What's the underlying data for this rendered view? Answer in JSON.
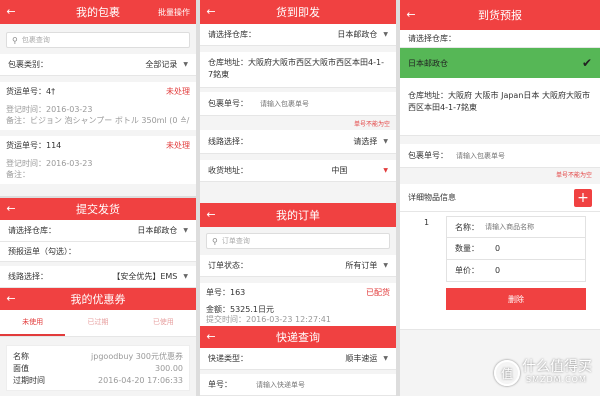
{
  "p1": {
    "title": "我的包裹",
    "action": "批量操作",
    "search_placeholder": "包裹查询",
    "category_label": "包裹类别：",
    "category_value": "全部记录",
    "items": [
      {
        "no_label": "货运单号：4†",
        "status": "未处理",
        "date": "登记时间：2016-03-23",
        "note": "备注：ビジョン 泡シャンプー ボトル 350ml (0 ≙/ι..."
      },
      {
        "no_label": "货运单号：114",
        "status": "未处理",
        "date": "登记时间：2016-03-23",
        "note": "备注："
      }
    ]
  },
  "p2": {
    "title": "提交发货",
    "warehouse_label": "请选择仓库：",
    "warehouse_value": "日本邮政仓",
    "prebook_label": "预报运单（勾选）：",
    "route_label": "线路选择：",
    "route_value": "【安全优先】EMS"
  },
  "p3": {
    "title": "我的优惠券",
    "tabs": [
      "未使用",
      "已过期",
      "已使用"
    ],
    "name_label": "名称",
    "name_value": "jpgoodbuy 300元优惠券",
    "value_label": "面值",
    "value_value": "300.00",
    "time_label": "过期时间",
    "time_value": "2016-04-20 17:06:33"
  },
  "p4": {
    "title": "货到即发",
    "warehouse_label": "请选择仓库：",
    "warehouse_value": "日本邮政仓",
    "address": "仓库地址：大阪府大阪市西区大阪市西区本田4-1-7銘東",
    "pkg_label": "包裹单号：",
    "pkg_placeholder": "请输入包裹单号",
    "error": "单号不能为空",
    "route_label": "线路选择：",
    "route_value": "请选择",
    "recv_label": "收货地址：",
    "recv_value": "中国"
  },
  "p5": {
    "title": "我的订单",
    "search_placeholder": "订单查询",
    "status_label": "订单状态：",
    "status_value": "所有订单",
    "order_no": "单号：163",
    "order_status": "已配货",
    "amount": "金额：5325.1日元",
    "time": "提交时间：2016-03-23 12:27:41"
  },
  "p6": {
    "title": "快递查询",
    "type_label": "快递类型：",
    "type_value": "顺丰速运",
    "no_label": "单号：",
    "no_placeholder": "请输入快递单号"
  },
  "p7": {
    "title": "到货预报",
    "warehouse_label": "请选择仓库：",
    "warehouse_selected": "日本邮政仓",
    "address": "仓库地址：大阪府 大阪市 Japan日本 大阪府大阪市西区本田4-1-7銘東",
    "pkg_label": "包裹单号：",
    "pkg_placeholder": "请输入包裹单号",
    "error": "单号不能为空",
    "detail_title": "详细物品信息",
    "item_index": "1",
    "name_label": "名称：",
    "name_placeholder": "请输入商品名称",
    "qty_label": "数量：",
    "qty_value": "0",
    "price_label": "单价：",
    "price_value": "0",
    "delete_label": "删除"
  },
  "watermark": {
    "big": "什么值得买",
    "small": "SMZDM.COM"
  }
}
